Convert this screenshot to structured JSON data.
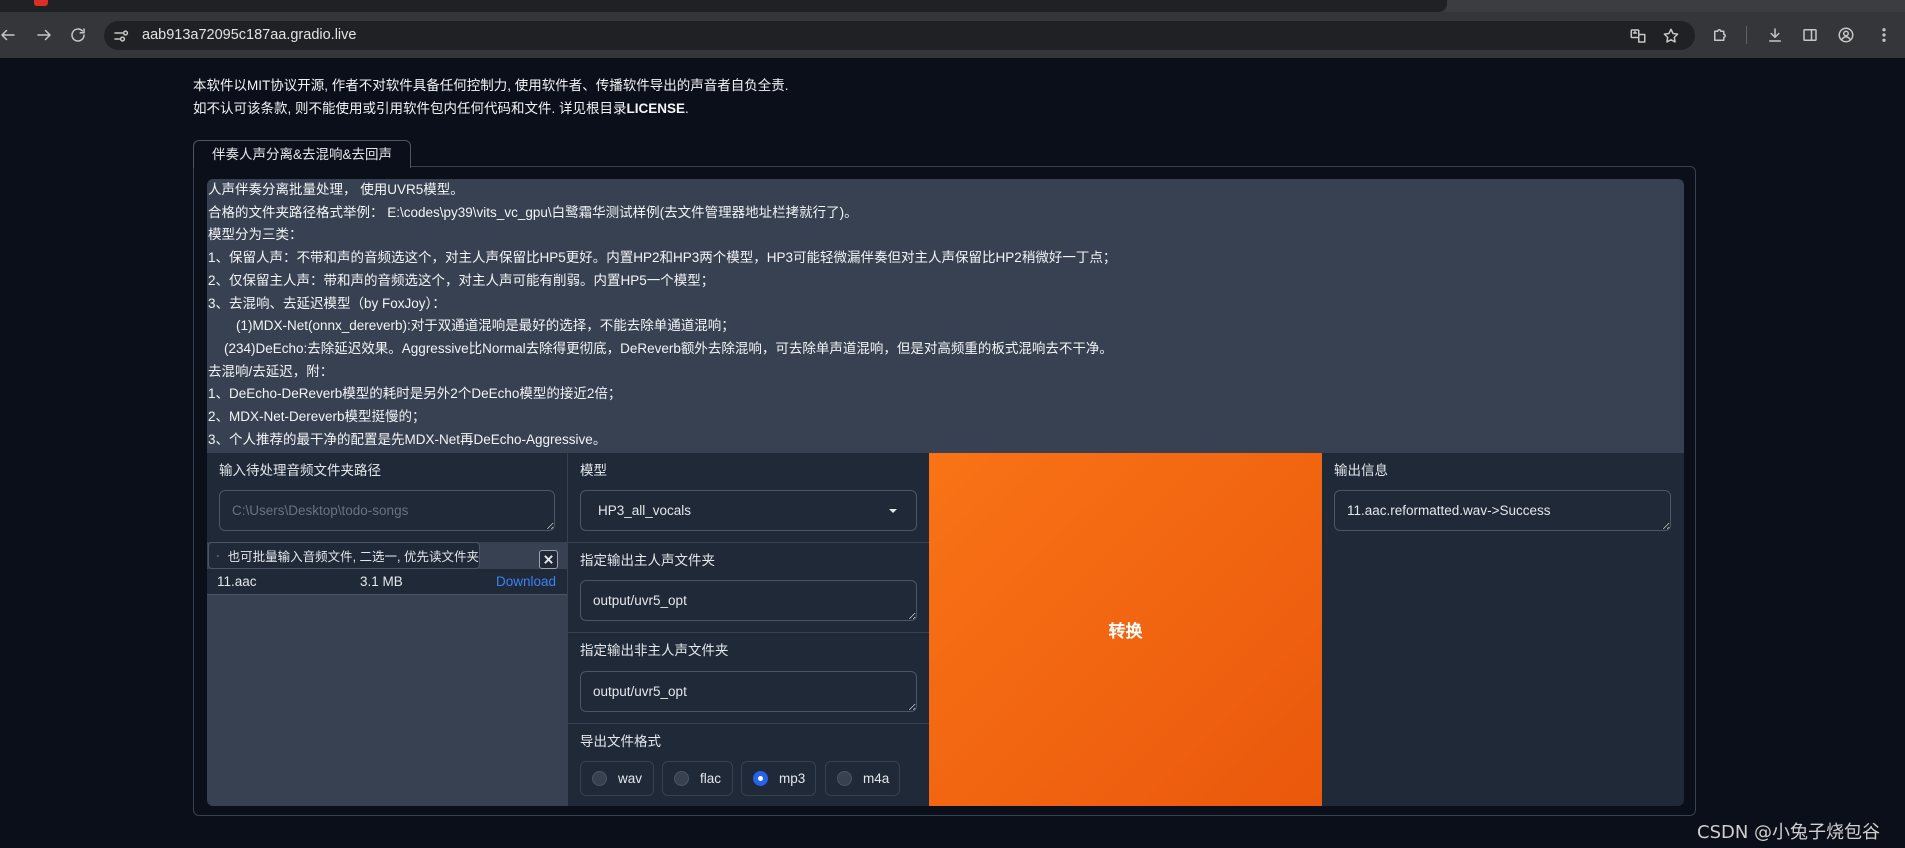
{
  "browser": {
    "url": "aab913a72095c187aa.gradio.live"
  },
  "notice": {
    "line1": "本软件以MIT协议开源, 作者不对软件具备任何控制力, 使用软件者、传播软件导出的声音者自负全责.",
    "line2_text": "如不认可该条款, 则不能使用或引用软件包内任何代码和文件. 详见根目录",
    "line2_bold": "LICENSE",
    "line2_end": "."
  },
  "tabs": [
    {
      "label": "伴奏人声分离&去混响&去回声",
      "active": true
    }
  ],
  "instructions": {
    "lines": [
      "人声伴奏分离批量处理， 使用UVR5模型。",
      "合格的文件夹路径格式举例： E:\\codes\\py39\\vits_vc_gpu\\白鹭霜华测试样例(去文件管理器地址栏拷就行了)。",
      "模型分为三类：",
      "1、保留人声：不带和声的音频选这个，对主人声保留比HP5更好。内置HP2和HP3两个模型，HP3可能轻微漏伴奏但对主人声保留比HP2稍微好一丁点；",
      "2、仅保留主人声：带和声的音频选这个，对主人声可能有削弱。内置HP5一个模型；",
      "3、去混响、去延迟模型（by FoxJoy）：",
      "(1)MDX-Net(onnx_dereverb):对于双通道混响是最好的选择，不能去除单通道混响；",
      "(234)DeEcho:去除延迟效果。Aggressive比Normal去除得更彻底，DeReverb额外去除混响，可去除单声道混响，但是对高频重的板式混响去不干净。",
      "去混响/去延迟，附：",
      "1、DeEcho-DeReverb模型的耗时是另外2个DeEcho模型的接近2倍；",
      "2、MDX-Net-Dereverb模型挺慢的；",
      "3、个人推荐的最干净的配置是先MDX-Net再DeEcho-Aggressive。"
    ]
  },
  "input_panel": {
    "dir_label": "输入待处理音频文件夹路径",
    "dir_placeholder": "C:\\Users\\Desktop\\todo-songs",
    "files_label": "也可批量输入音频文件, 二选一, 优先读文件夹",
    "files": [
      {
        "name": "11.aac",
        "size": "3.1 MB",
        "action": "Download"
      }
    ]
  },
  "settings": {
    "model_label": "模型",
    "model_value": "HP3_all_vocals",
    "vocal_dir_label": "指定输出主人声文件夹",
    "vocal_dir_value": "output/uvr5_opt",
    "ins_dir_label": "指定输出非主人声文件夹",
    "ins_dir_value": "output/uvr5_opt",
    "format_label": "导出文件格式",
    "format_options": [
      "wav",
      "flac",
      "mp3",
      "m4a"
    ],
    "format_selected": "mp3"
  },
  "convert_button": {
    "label": "转换"
  },
  "output": {
    "label": "输出信息",
    "value": "11.aac.reformatted.wav->Success"
  },
  "watermark": "CSDN @小兔子烧包谷",
  "colors": {
    "page_bg": "#0b0f19",
    "block_bg": "#1f2937",
    "instructions_bg": "#374151",
    "accent_orange": "#f97316",
    "radio_selected": "#2563eb",
    "link_blue": "#3b82f6"
  }
}
